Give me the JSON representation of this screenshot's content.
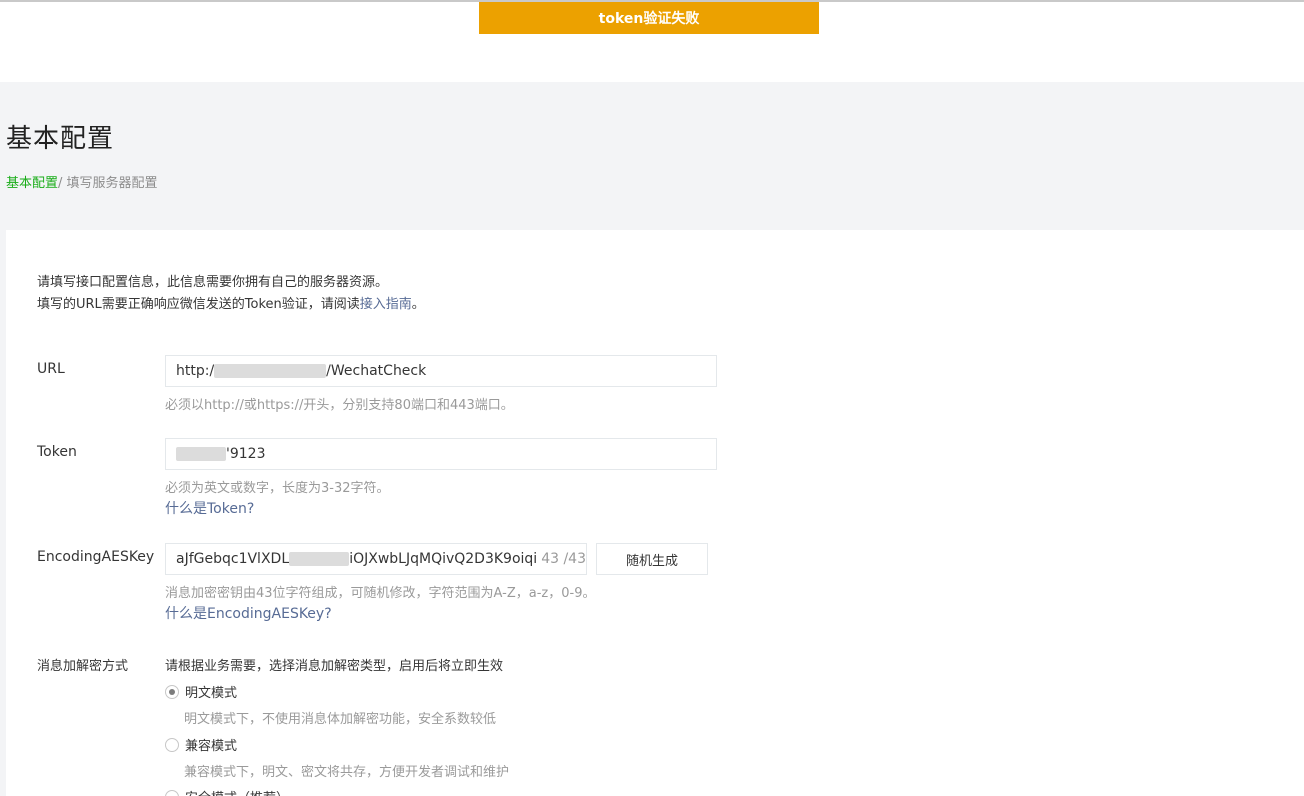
{
  "toast": {
    "message": "token验证失败",
    "color": "#eca100"
  },
  "page": {
    "title": "基本配置"
  },
  "breadcrumb": {
    "root": "基本配置",
    "separator": "/",
    "current": " 填写服务器配置"
  },
  "intro": {
    "line1": "请填写接口配置信息，此信息需要你拥有自己的服务器资源。",
    "line2_prefix": "填写的URL需要正确响应微信发送的Token验证，请阅读",
    "line2_link": "接入指南",
    "line2_suffix": "。"
  },
  "url_field": {
    "label": "URL",
    "value_prefix": "http:/",
    "value_suffix": "/WechatCheck",
    "tip": "必须以http://或https://开头，分别支持80端口和443端口。"
  },
  "token_field": {
    "label": "Token",
    "value_suffix": "'9123",
    "tip": "必须为英文或数字，长度为3-32字符。",
    "help_link": "什么是Token?"
  },
  "aes_field": {
    "label": "EncodingAESKey",
    "value_prefix": "aJfGebqc1VlXDL",
    "value_suffix": "iOJXwbLJqMQivQ2D3K9oiqi",
    "counter": "43 /43",
    "generate_button": "随机生成",
    "tip": "消息加密密钥由43位字符组成，可随机修改，字符范围为A-Z，a-z，0-9。",
    "help_link": "什么是EncodingAESKey?"
  },
  "encryption": {
    "label": "消息加解密方式",
    "description": "请根据业务需要，选择消息加解密类型，启用后将立即生效",
    "options": [
      {
        "label": "明文模式",
        "desc": "明文模式下，不使用消息体加解密功能，安全系数较低",
        "checked": true
      },
      {
        "label": "兼容模式",
        "desc": "兼容模式下，明文、密文将共存，方便开发者调试和维护",
        "checked": false
      },
      {
        "label": "安全模式（推荐）",
        "desc": "",
        "checked": false
      }
    ]
  },
  "colors": {
    "link": "#576b95",
    "brand_green": "#1aad19",
    "header_bg": "#f3f4f6"
  }
}
